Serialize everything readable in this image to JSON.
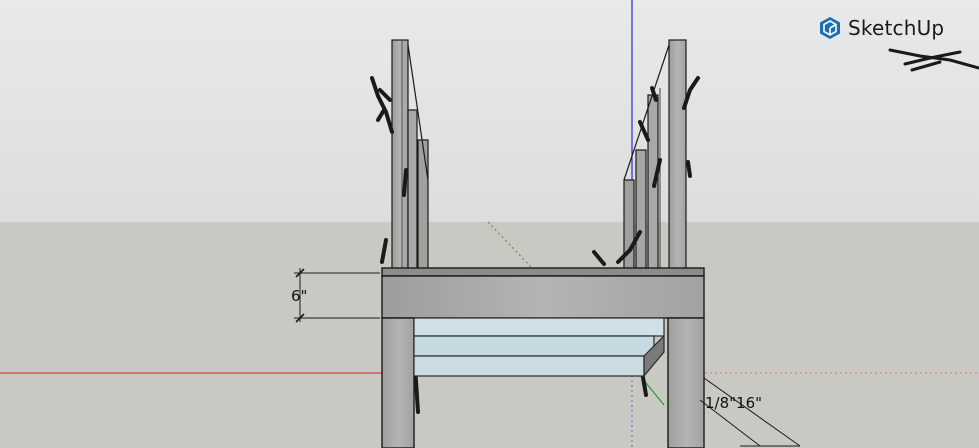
{
  "app": {
    "name": "SketchUp"
  },
  "colors": {
    "sky_top": "#ededed",
    "sky_bottom": "#dcdcdc",
    "ground": "#c7c7c2",
    "wood": "#a9a9a7",
    "glass": "#c8dde4",
    "red_axis": "#e23a3a",
    "blue_axis": "#2b2bd9",
    "green_axis": "#2c9b2c"
  },
  "dimensions": {
    "vertical_label": "6\"",
    "diagonal_label": "1/8\"16\""
  },
  "icons": [
    "sketchup-logo-icon"
  ]
}
